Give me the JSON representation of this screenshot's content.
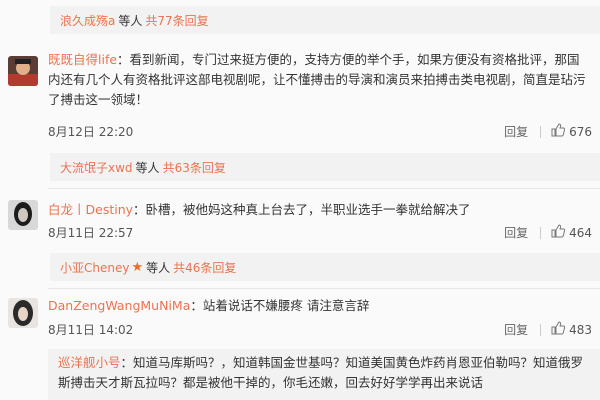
{
  "strip1": {
    "name": "浪久成殇a",
    "mid": "等人",
    "count": "共77条回复"
  },
  "c1": {
    "username": "既既自得life",
    "text": "：看到新闻，专门过来挺方便的，支持方便的举个手，如果方便没有资格批评，那国内还有几个人有资格批评这部电视剧呢，让不懂搏击的导演和演员来拍搏击类电视剧，简直是玷污了搏击这一领域！",
    "time": "8月12日 22:20",
    "reply": "回复",
    "likes": "676"
  },
  "strip2": {
    "name": "大流氓子xwd",
    "mid": "等人",
    "count": "共63条回复"
  },
  "c2": {
    "username": "白龙丨Destiny",
    "text": "：卧槽，被他妈这种真上台去了，半职业选手一拳就给解决了",
    "time": "8月11日 22:57",
    "reply": "回复",
    "likes": "464"
  },
  "strip3": {
    "name": "小亚Cheney",
    "mid": "等人",
    "count": "共46条回复"
  },
  "c3": {
    "username": "DanZengWangMuNiMa",
    "text": "：站着说话不嫌腰疼 请注意言辞",
    "time": "8月11日 14:02",
    "reply": "回复",
    "likes": "483"
  },
  "sub": {
    "username": "巡洋舰小号",
    "text": "：知道马库斯吗？，知道韩国金世基吗？知道美国黄色炸药肖恩亚伯勒吗？知道俄罗斯搏击天才斯瓦拉吗？都是被他干掉的，你毛还嫩，回去好好学学再出来说话"
  },
  "icons": {
    "like": "thumbs-up-icon",
    "star": "star-icon"
  },
  "colors": {
    "link": "#eb7350",
    "strip_bg": "#f2f2f2",
    "star": "#f26a2a"
  }
}
